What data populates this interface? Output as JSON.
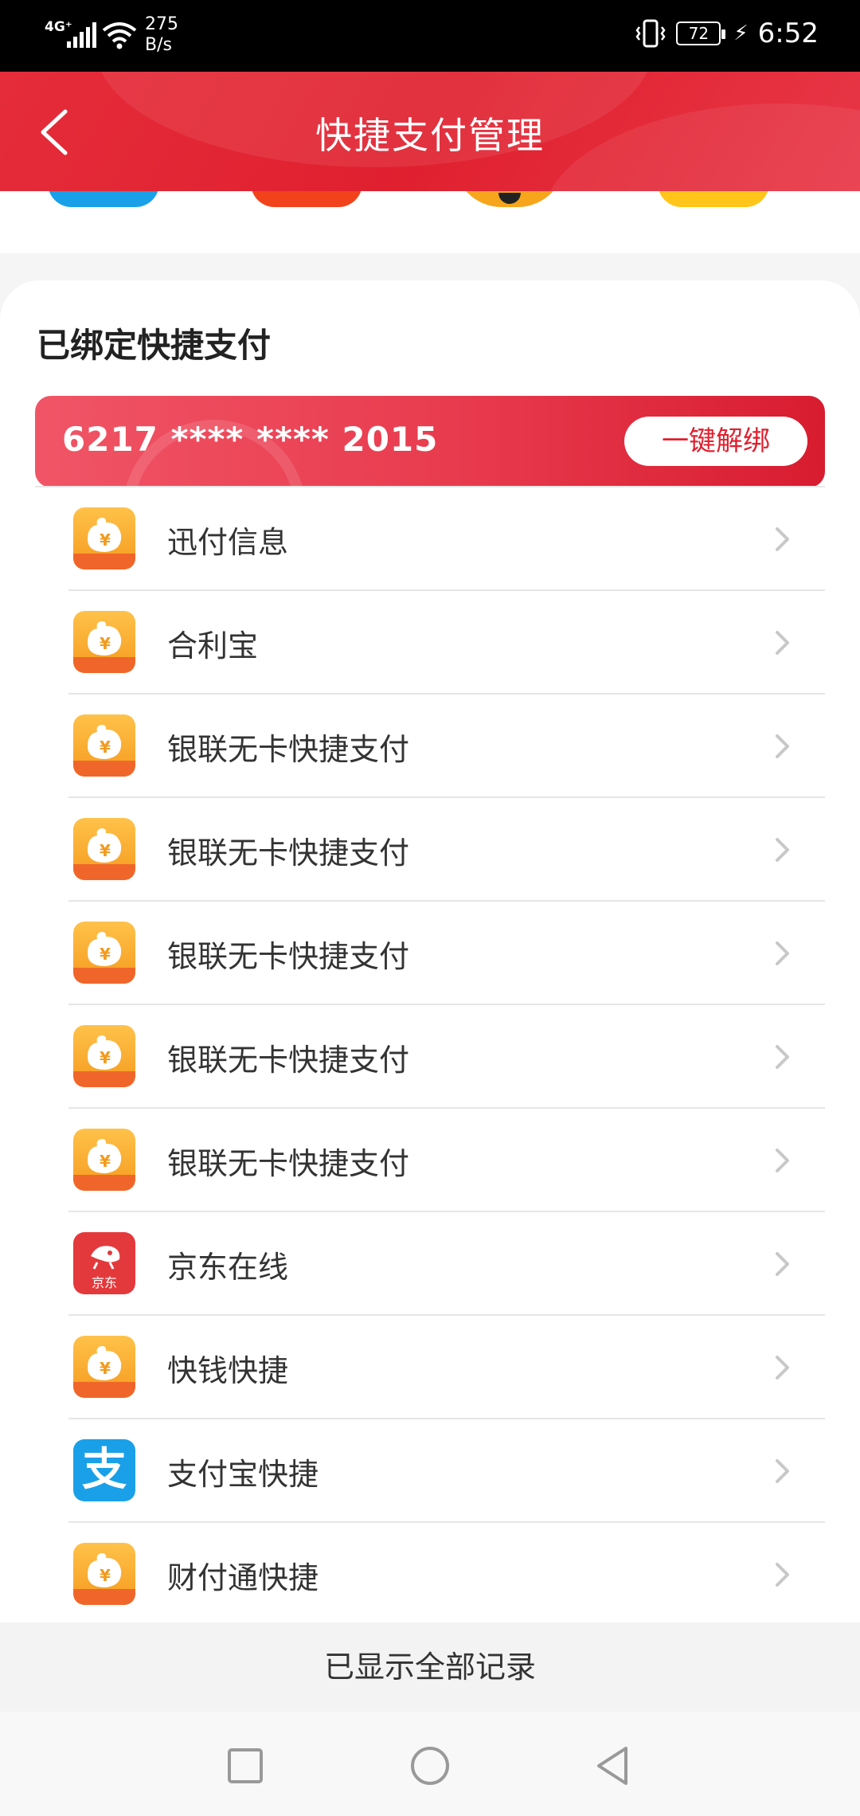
{
  "status_bar": {
    "network": "4G⁺",
    "speed_value": "275",
    "speed_unit": "B/s",
    "battery": "72",
    "time": "6:52"
  },
  "header": {
    "title": "快捷支付管理"
  },
  "section": {
    "title": "已绑定快捷支付"
  },
  "bank_card": {
    "number": "6217 **** **** 2015",
    "unbind_label": "一键解绑"
  },
  "payments": [
    {
      "label": "迅付信息",
      "icon": "coin-bag-icon"
    },
    {
      "label": "合利宝",
      "icon": "coin-bag-icon"
    },
    {
      "label": "银联无卡快捷支付",
      "icon": "coin-bag-icon"
    },
    {
      "label": "银联无卡快捷支付",
      "icon": "coin-bag-icon"
    },
    {
      "label": "银联无卡快捷支付",
      "icon": "coin-bag-icon"
    },
    {
      "label": "银联无卡快捷支付",
      "icon": "coin-bag-icon"
    },
    {
      "label": "银联无卡快捷支付",
      "icon": "coin-bag-icon"
    },
    {
      "label": "京东在线",
      "icon": "jd-logo-icon"
    },
    {
      "label": "快钱快捷",
      "icon": "coin-bag-icon"
    },
    {
      "label": "支付宝快捷",
      "icon": "alipay-logo-icon"
    },
    {
      "label": "财付通快捷",
      "icon": "coin-bag-icon"
    }
  ],
  "icon_texts": {
    "jd_text": "京东",
    "alipay_glyph": "支"
  },
  "footer": {
    "note": "已显示全部记录"
  },
  "colors": {
    "accent_red": "#e0202f",
    "orange_icon": "#f5a623",
    "jd_red": "#e4393c",
    "alipay_blue": "#1aa0e8"
  }
}
